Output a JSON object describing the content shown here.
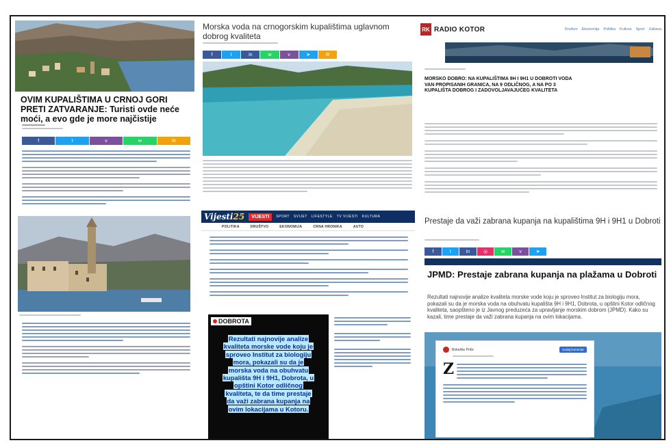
{
  "col1": {
    "headline": "OVIM KUPALIŠTIMA U CRNOJ GORI PRETI ZATVARANJE: Turisti ovde neće moći, a evo gde je more najčistije"
  },
  "col2": {
    "headline": "Morska voda na crnogorskim kupalištima uglavnom dobrog kvaliteta",
    "vijesti": {
      "logo": "Vijesti",
      "logo_num": "25",
      "badge": "VIJESTI",
      "nav": [
        "SPORT",
        "SVIJET",
        "LIFESTYLE",
        "TV VIJESTI",
        "KULTURA"
      ],
      "subnav": [
        "POLITIKA",
        "DRUŠTVO",
        "EKONOMIJA",
        "CRNA HRONIKA",
        "AUTO"
      ]
    },
    "dobrota": {
      "tag": "DOBROTA",
      "text": "Rezultati najnovije analize kvaliteta morske vode koju je sproveo Institut za biologiju mora, pokazali su da je morska voda na obuhvatu kupališta 9H i 9H1, Dobrota, u opštini Kotor odličnog kvaliteta, te da time prestaje da važi zabrana kupanja na ovim lokacijama u Kotoru."
    }
  },
  "col3": {
    "logo_mark": "RK",
    "site_name": "RADIO KOTOR",
    "nav": [
      "Društvo",
      "Ekonomija",
      "Politika",
      "Kultura",
      "Sport",
      "Zabava"
    ],
    "headline": "MORSKO DOBRO: NA KUPALIŠTIMA 9H I 9H1 U DOBROTI VODA VAN PROPISANIH GRANICA, NA 9 ODLIČNOG, A NA PO 3 KUPALIŠTA DOBROG I ZADOVOLJAVAJUĆEG KVALITETA",
    "title2": "Prestaje da važi zabrana kupanja na kupalištima 9H i 9H1 u Dobroti",
    "jpmd_title": "JPMD: Prestaje zabrana kupanja na plažama u Dobroti",
    "jpmd_text": "Rezultati najnovije analize kvaliteta morske vode koju je sproveo Institut za biologiju mora, pokazali su da je morska voda na obuhvatu kupališta 9H i 9H1, Dobrota, u opštini Kotor odličnog kvaliteta, saopšteno je iz Javnog preduzeća za upravljanje morskim dobrom (JPMD). Kako su kazali, time prestaje da važi zabrana kupanja na ovim lokacijama.",
    "embed": {
      "initial": "Z",
      "source": "Bokeške Priče",
      "button": "Dodaj komentar"
    }
  },
  "colors": {
    "share_facebook": "#3b5998",
    "share_twitter": "#1da1f2",
    "share_viber": "#7b519d",
    "share_whatsapp": "#25d366",
    "share_mail": "#f0a30a",
    "vijesti_navy": "#0d2f64",
    "vijesti_red": "#e32b2b",
    "radio_kotor_red": "#b12a2a",
    "dobrota_text": "#0d2f94",
    "dobrota_highlight": "#b9e9ff"
  }
}
